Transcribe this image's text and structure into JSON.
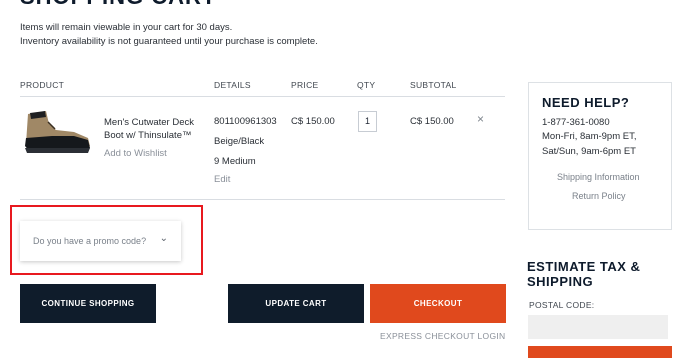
{
  "header": {
    "title": "SHOPPING CART",
    "notice_line1": "Items will remain viewable in your cart for 30 days.",
    "notice_line2": "Inventory availability is not guaranteed until your purchase is complete."
  },
  "columns": {
    "product": "PRODUCT",
    "details": "DETAILS",
    "price": "PRICE",
    "qty": "QTY",
    "subtotal": "SUBTOTAL"
  },
  "cart_item": {
    "name": "Men's Cutwater Deck Boot w/ Thinsulate™",
    "wishlist": "Add to Wishlist",
    "sku": "801100961303",
    "color": "Beige/Black",
    "size": "9 Medium",
    "edit": "Edit",
    "price": "C$ 150.00",
    "qty": "1",
    "subtotal": "C$ 150.00",
    "remove": "×"
  },
  "promo": {
    "label": "Do you have a promo code?",
    "chevron": "⌄"
  },
  "buttons": {
    "continue": "CONTINUE SHOPPING",
    "update": "UPDATE CART",
    "checkout": "CHECKOUT",
    "express": "EXPRESS CHECKOUT LOGIN"
  },
  "help": {
    "title": "NEED HELP?",
    "phone": "1-877-361-0080",
    "hours_weekday": "Mon-Fri, 8am-9pm ET,",
    "hours_weekend": "Sat/Sun, 9am-6pm ET",
    "shipping_link": "Shipping Information",
    "return_link": "Return Policy"
  },
  "tax": {
    "title": "ESTIMATE TAX & SHIPPING",
    "postal_label": "POSTAL CODE:",
    "postal_value": ""
  },
  "colors": {
    "navy": "#0f1c2b",
    "orange": "#e0491d",
    "highlight": "#e8191f"
  }
}
